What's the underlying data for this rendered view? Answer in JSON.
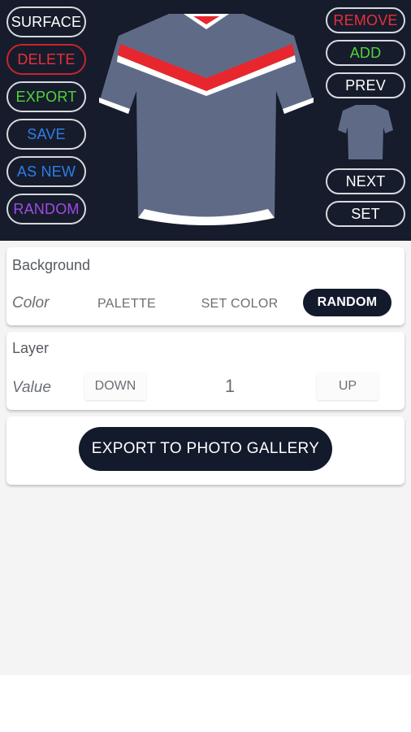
{
  "top_toolbar": {
    "left_buttons": [
      {
        "label": "SURFACE",
        "color": "#ffffff"
      },
      {
        "label": "DELETE",
        "color": "#e8303a"
      },
      {
        "label": "EXPORT",
        "color": "#52d23a"
      },
      {
        "label": "SAVE",
        "color": "#2f7de8"
      },
      {
        "label": "AS NEW",
        "color": "#2f7de8"
      },
      {
        "label": "RANDOM",
        "color": "#a14be3"
      }
    ],
    "right_buttons": [
      {
        "label": "REMOVE",
        "color": "#e8303a"
      },
      {
        "label": "ADD",
        "color": "#52d23a"
      },
      {
        "label": "PREV",
        "color": "#ffffff"
      },
      {
        "label": "NEXT",
        "color": "#ffffff"
      },
      {
        "label": "SET",
        "color": "#ffffff"
      }
    ]
  },
  "background_card": {
    "title": "Background",
    "row_label": "Color",
    "palette_label": "PALETTE",
    "set_color_label": "SET COLOR",
    "random_label": "RANDOM"
  },
  "layer_card": {
    "title": "Layer",
    "row_label": "Value",
    "down_label": "DOWN",
    "value": "1",
    "up_label": "UP"
  },
  "export_card": {
    "button_label": "EXPORT TO PHOTO GALLERY"
  },
  "colors": {
    "toolbar_bg": "#161c2c",
    "shirt_body": "#5f6b86",
    "stripe_red": "#e8262e",
    "stripe_white": "#ffffff",
    "dark_button": "#131a2b"
  }
}
